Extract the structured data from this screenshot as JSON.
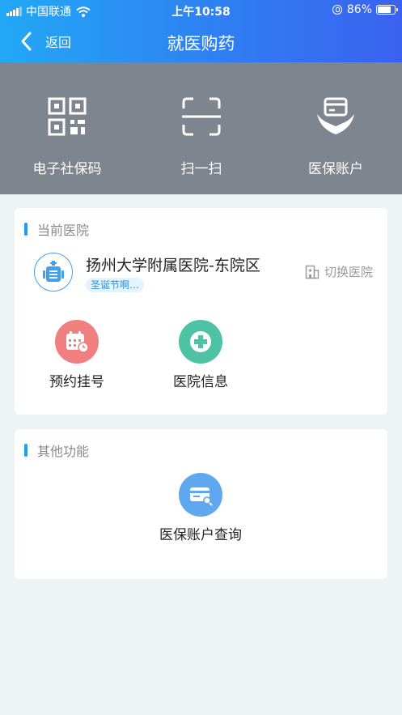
{
  "status_bar": {
    "carrier": "中国联通",
    "time": "上午10:58",
    "battery": "86%",
    "battery_level": 0.86
  },
  "header": {
    "back_label": "返回",
    "title": "就医购药"
  },
  "quick_actions": [
    {
      "label": "电子社保码",
      "icon": "qr-code-icon"
    },
    {
      "label": "扫一扫",
      "icon": "scan-icon"
    },
    {
      "label": "医保账户",
      "icon": "card-in-hands-icon"
    }
  ],
  "current_hospital": {
    "section_title": "当前医院",
    "name": "扬州大学附属医院-东院区",
    "tag": "圣诞节啊…",
    "switch_label": "切换医院",
    "functions": [
      {
        "label": "预约挂号",
        "icon": "calendar-clock-icon",
        "color": "#f07f7f"
      },
      {
        "label": "医院信息",
        "icon": "medical-cross-icon",
        "color": "#4ec2a5"
      }
    ]
  },
  "other": {
    "section_title": "其他功能",
    "functions": [
      {
        "label": "医保账户查询",
        "icon": "card-search-icon",
        "color": "#5fa8ef"
      }
    ]
  },
  "colors": {
    "header_start": "#22a8f5",
    "header_end": "#3a62f0",
    "quick_bg": "#7f858f",
    "accent": "#1aa0f0"
  }
}
